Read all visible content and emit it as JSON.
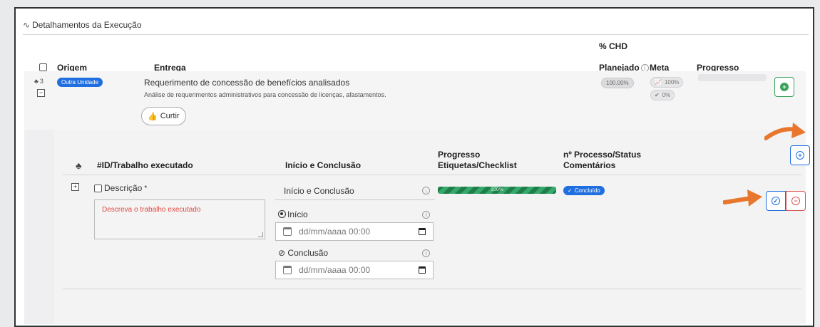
{
  "section": {
    "title": "Detalhamentos da Execução"
  },
  "table": {
    "headers": {
      "origem": "Origem",
      "entrega": "Entrega",
      "chd_line1": "% CHD",
      "chd_line2": "Planejado",
      "meta": "Meta",
      "progresso": "Progresso"
    },
    "row": {
      "count_badge": "3",
      "origem_badge": "Outra Unidade",
      "entrega_title": "Requerimento de concessão de benefícios analisados",
      "entrega_desc": "Análise de requerimentos administrativos para concessão de licenças, afastamentos.",
      "curtir_label": "Curtir",
      "chd_value": "100.00%",
      "meta_line1": "100%",
      "meta_line2": "0%",
      "progress_fraction": 0
    }
  },
  "subtable": {
    "headers": {
      "id_trabalho": "#ID/Trabalho executado",
      "inicio_conclusao": "Início e Conclusão",
      "progresso_line1": "Progresso",
      "progresso_line2": "Etiquetas/Checklist",
      "processo_line1": "nº Processo/Status",
      "processo_line2": "Comentários"
    },
    "form": {
      "descricao_label": "Descrição",
      "required_mark": "*",
      "descricao_placeholder": "Descreva o trabalho executado",
      "inicio_conclusao_label": "Início e Conclusão",
      "inicio_label": "Início",
      "inicio_placeholder": "dd/mm/aaaa 00:00",
      "conclusao_label": "Conclusão",
      "conclusao_placeholder": "dd/mm/aaaa 00:00",
      "progress_label": "100%",
      "progress_fraction": 1,
      "status_badge": "Concluído"
    }
  },
  "colors": {
    "accent_blue": "#1f6fe0",
    "success_green": "#3aa35b",
    "danger_red": "#d9534f",
    "annotation_orange": "#e8762d"
  },
  "icons": [
    "pulse-icon",
    "info-icon",
    "thumbs-up-icon",
    "plus-circle-icon",
    "check-circle-icon",
    "minus-circle-icon",
    "calendar-icon",
    "sitemap-icon",
    "radio-icon"
  ]
}
